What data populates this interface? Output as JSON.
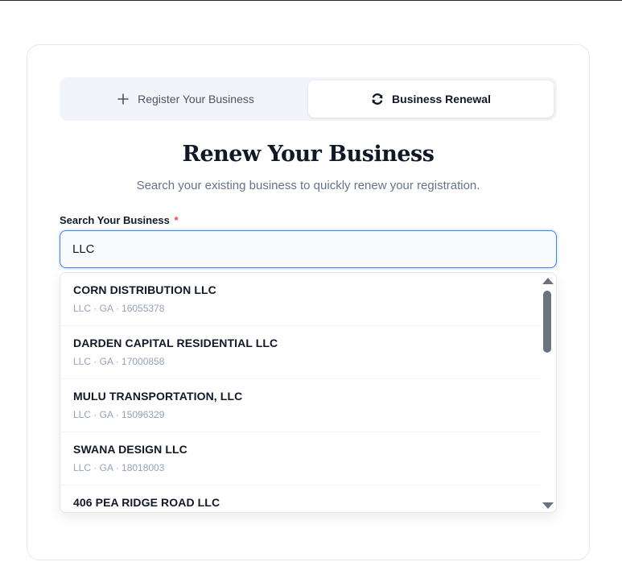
{
  "tabs": [
    {
      "label": "Register Your Business",
      "icon": "plus-icon",
      "active": false
    },
    {
      "label": "Business Renewal",
      "icon": "refresh-icon",
      "active": true
    }
  ],
  "header": {
    "title": "Renew Your Business",
    "subtitle": "Search your existing business to quickly renew your registration."
  },
  "search": {
    "label": "Search Your Business",
    "required_mark": "*",
    "value": "LLC"
  },
  "results": [
    {
      "name": "CORN DISTRIBUTION LLC",
      "meta": "LLC · GA · 16055378"
    },
    {
      "name": "DARDEN CAPITAL RESIDENTIAL LLC",
      "meta": "LLC · GA · 17000858"
    },
    {
      "name": "MULU TRANSPORTATION, LLC",
      "meta": "LLC · GA · 15096329"
    },
    {
      "name": "SWANA DESIGN LLC",
      "meta": "LLC · GA · 18018003"
    },
    {
      "name": "406 PEA RIDGE ROAD LLC",
      "meta": ""
    }
  ],
  "colors": {
    "accent": "#3b82f6",
    "required": "#ef4444",
    "muted": "#94a3b8"
  }
}
